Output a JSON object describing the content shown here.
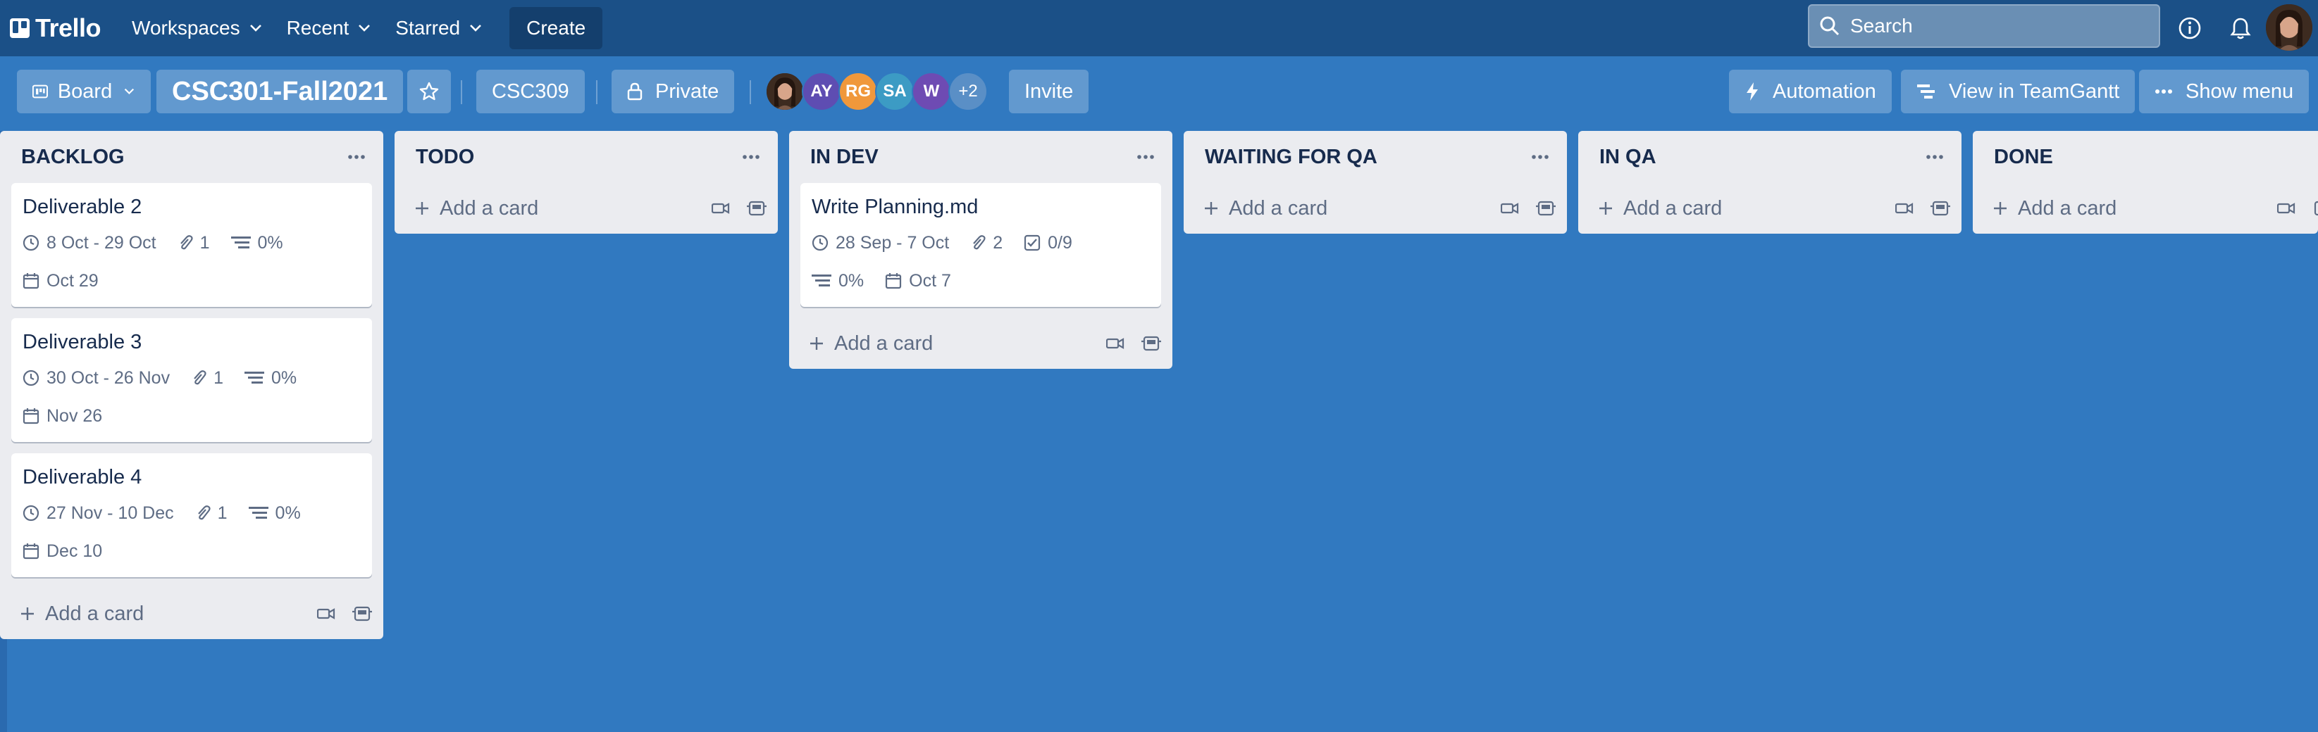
{
  "app": {
    "name": "Trello"
  },
  "nav": {
    "workspaces": "Workspaces",
    "recent": "Recent",
    "starred": "Starred",
    "create": "Create",
    "search_placeholder": "Search"
  },
  "board": {
    "view_label": "Board",
    "title": "CSC301-Fall2021",
    "team": "CSC309",
    "visibility": "Private",
    "members": [
      {
        "initials": "",
        "color": "#5b3a29",
        "photo": true
      },
      {
        "initials": "AY",
        "color": "#5e4db2"
      },
      {
        "initials": "RG",
        "color": "#f0983b"
      },
      {
        "initials": "SA",
        "color": "#3c9bc4"
      },
      {
        "initials": "W",
        "color": "#6e4bb3"
      }
    ],
    "members_more": "+2",
    "invite": "Invite",
    "automation": "Automation",
    "teamgantt": "View in TeamGantt",
    "show_menu": "Show menu"
  },
  "add_card_label": "Add a card",
  "lists": [
    {
      "title": "BACKLOG",
      "cards": [
        {
          "title": "Deliverable 2",
          "dates": "8 Oct - 29 Oct",
          "attachments": "1",
          "progress": "0%",
          "due": "Oct 29"
        },
        {
          "title": "Deliverable 3",
          "dates": "30 Oct - 26 Nov",
          "attachments": "1",
          "progress": "0%",
          "due": "Nov 26"
        },
        {
          "title": "Deliverable 4",
          "dates": "27 Nov - 10 Dec",
          "attachments": "1",
          "progress": "0%",
          "due": "Dec 10"
        }
      ]
    },
    {
      "title": "TODO",
      "cards": []
    },
    {
      "title": "IN DEV",
      "cards": [
        {
          "title": "Write Planning.md",
          "dates": "28 Sep - 7 Oct",
          "attachments": "2",
          "checklist": "0/9",
          "progress": "0%",
          "due": "Oct 7"
        }
      ]
    },
    {
      "title": "WAITING FOR QA",
      "cards": []
    },
    {
      "title": "IN QA",
      "cards": []
    },
    {
      "title": "DONE",
      "cards": []
    }
  ],
  "colors": {
    "board_bg": "#3179c0",
    "topbar": "#1b5087",
    "list_bg": "#ebecf0"
  },
  "icons": [
    "trello-logo-icon",
    "chevron-down-icon",
    "search-icon",
    "info-icon",
    "bell-icon",
    "board-icon",
    "star-icon",
    "lock-icon",
    "bolt-icon",
    "gantt-icon",
    "ellipsis-icon",
    "clock-icon",
    "paperclip-icon",
    "progress-icon",
    "checklist-icon",
    "calendar-icon",
    "plus-icon",
    "video-icon",
    "template-icon"
  ]
}
